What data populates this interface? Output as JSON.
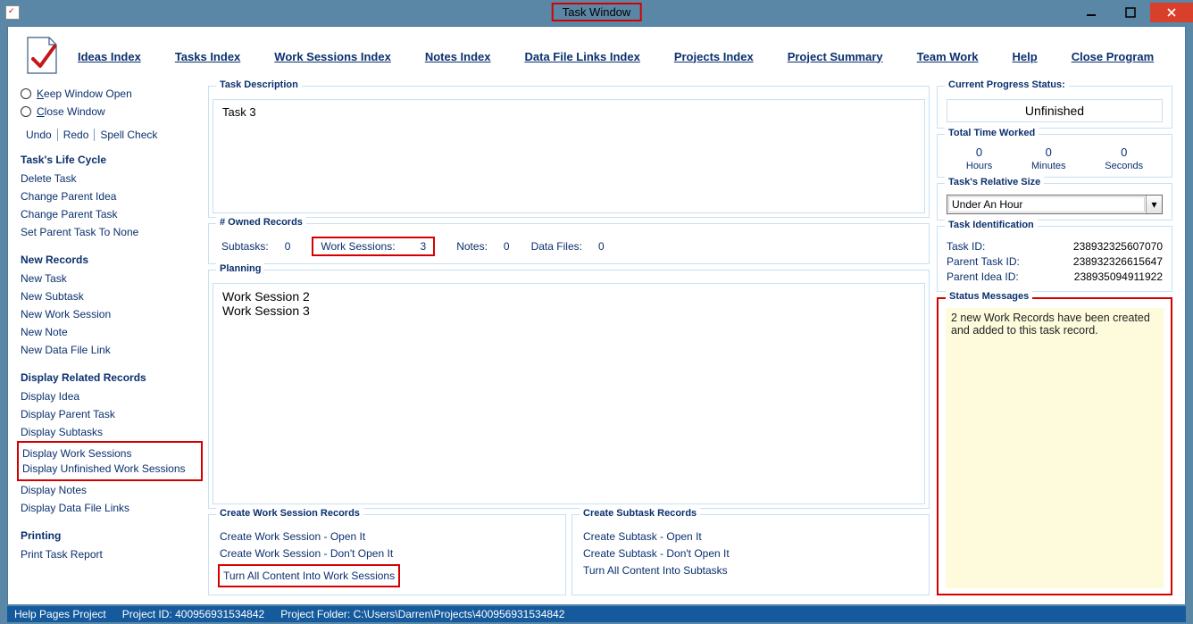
{
  "window": {
    "title": "Task Window"
  },
  "menu": {
    "ideas": "Ideas Index",
    "tasks": "Tasks Index",
    "work": "Work Sessions Index",
    "notes": "Notes Index",
    "data": "Data File Links Index",
    "projects": "Projects Index",
    "summary": "Project Summary",
    "team": "Team Work",
    "help": "Help",
    "close": "Close Program"
  },
  "left": {
    "keep": "Keep Window Open",
    "close": "Close Window",
    "undo": "Undo",
    "redo": "Redo",
    "spell": "Spell Check",
    "h_life": "Task's Life Cycle",
    "delete": "Delete Task",
    "chg_idea": "Change Parent Idea",
    "chg_task": "Change Parent Task",
    "set_none": "Set Parent Task To None",
    "h_new": "New Records",
    "new_task": "New Task",
    "new_sub": "New Subtask",
    "new_ws": "New Work Session",
    "new_note": "New Note",
    "new_dfl": "New Data File Link",
    "h_disp": "Display Related Records",
    "d_idea": "Display Idea",
    "d_parent": "Display Parent Task",
    "d_sub": "Display Subtasks",
    "d_ws": "Display Work Sessions",
    "d_uws": "Display Unfinished Work Sessions",
    "d_notes": "Display Notes",
    "d_dfl": "Display Data File Links",
    "h_print": "Printing",
    "print": "Print Task Report"
  },
  "taskdesc": {
    "label": "Task Description",
    "value": "Task 3"
  },
  "owned": {
    "label": "# Owned Records",
    "subtasks_l": "Subtasks:",
    "subtasks_v": "0",
    "ws_l": "Work Sessions:",
    "ws_v": "3",
    "notes_l": "Notes:",
    "notes_v": "0",
    "data_l": "Data Files:",
    "data_v": "0"
  },
  "planning": {
    "label": "Planning",
    "line1": "Work Session 2",
    "line2": "Work Session 3"
  },
  "create_ws": {
    "label": "Create Work Session Records",
    "open": "Create Work Session - Open It",
    "noopen": "Create Work Session - Don't Open It",
    "all": "Turn All Content Into Work Sessions"
  },
  "create_sub": {
    "label": "Create Subtask Records",
    "open": "Create Subtask - Open It",
    "noopen": "Create Subtask - Don't Open It",
    "all": "Turn All Content Into Subtasks"
  },
  "right": {
    "progress_l": "Current Progress Status:",
    "progress_v": "Unfinished",
    "time_l": "Total Time Worked",
    "hours_v": "0",
    "hours_l": "Hours",
    "mins_v": "0",
    "mins_l": "Minutes",
    "secs_v": "0",
    "secs_l": "Seconds",
    "size_l": "Task's Relative Size",
    "size_v": "Under An Hour",
    "ident_l": "Task Identification",
    "task_id_l": "Task ID:",
    "task_id_v": "238932325607070",
    "ptask_id_l": "Parent Task ID:",
    "ptask_id_v": "238932326615647",
    "pidea_id_l": "Parent Idea ID:",
    "pidea_id_v": "238935094911922",
    "status_l": "Status Messages",
    "status_v": "2 new Work Records have been created and added to this task record."
  },
  "statusbar": {
    "help": "Help Pages Project",
    "pid_l": "Project ID: ",
    "pid_v": "400956931534842",
    "folder_l": "Project Folder: ",
    "folder_v": "C:\\Users\\Darren\\Projects\\400956931534842"
  }
}
